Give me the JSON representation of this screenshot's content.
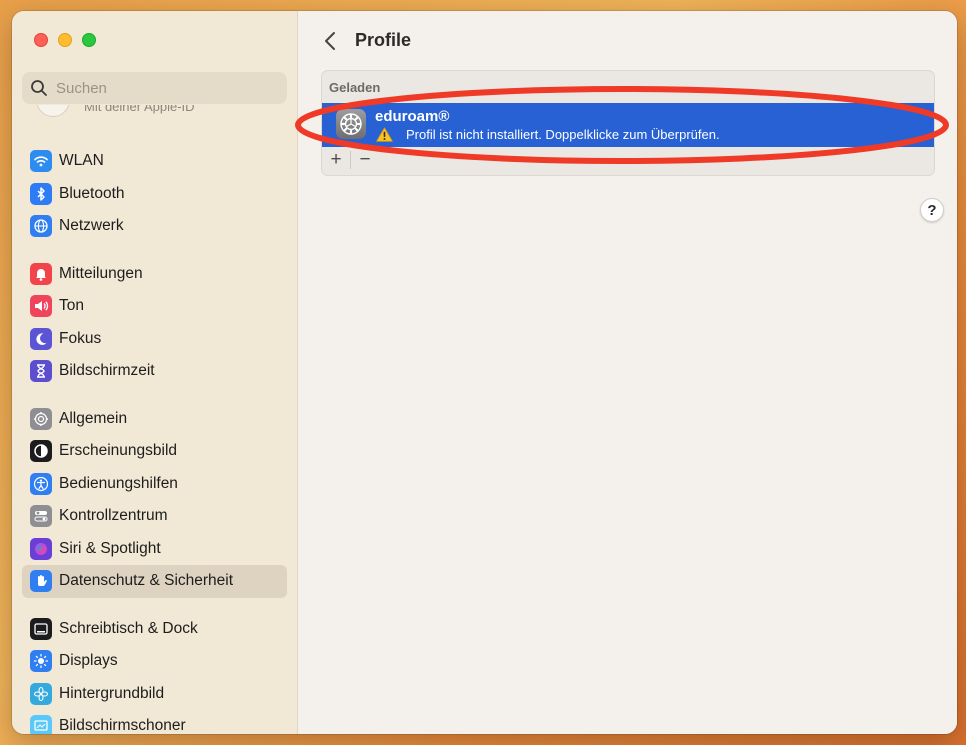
{
  "window": {
    "traffic_lights": [
      "close",
      "minimize",
      "zoom"
    ]
  },
  "sidebar": {
    "search": {
      "placeholder": "Suchen",
      "value": ""
    },
    "apple_id_fragment": "Mit deiner Apple-ID",
    "groups": [
      [
        {
          "label": "WLAN",
          "icon": "wifi-icon",
          "color": "#2d8cf0"
        },
        {
          "label": "Bluetooth",
          "icon": "bluetooth-icon",
          "color": "#2d7cf6"
        },
        {
          "label": "Netzwerk",
          "icon": "globe-icon",
          "color": "#2f7ef2"
        }
      ],
      [
        {
          "label": "Mitteilungen",
          "icon": "bell-icon",
          "color": "#f2454b"
        },
        {
          "label": "Ton",
          "icon": "speaker-icon",
          "color": "#f0445c"
        },
        {
          "label": "Fokus",
          "icon": "moon-icon",
          "color": "#5b55d6"
        },
        {
          "label": "Bildschirmzeit",
          "icon": "hourglass-icon",
          "color": "#5b4fd0"
        }
      ],
      [
        {
          "label": "Allgemein",
          "icon": "gear-icon",
          "color": "#8e8e93"
        },
        {
          "label": "Erscheinungsbild",
          "icon": "appearance-icon",
          "color": "#1c1c1e"
        },
        {
          "label": "Bedienungshilfen",
          "icon": "accessibility-icon",
          "color": "#2f7ef2"
        },
        {
          "label": "Kontrollzentrum",
          "icon": "toggles-icon",
          "color": "#8e8e93"
        },
        {
          "label": "Siri & Spotlight",
          "icon": "siri-icon",
          "color": "#6a3fd6"
        },
        {
          "label": "Datenschutz & Sicherheit",
          "icon": "hand-icon",
          "color": "#2f7ef2",
          "selected": true
        }
      ],
      [
        {
          "label": "Schreibtisch & Dock",
          "icon": "dock-icon",
          "color": "#1c1c1e"
        },
        {
          "label": "Displays",
          "icon": "sun-icon",
          "color": "#2f7ef2"
        },
        {
          "label": "Hintergrundbild",
          "icon": "flower-icon",
          "color": "#34aadc"
        },
        {
          "label": "Bildschirmschoner",
          "icon": "screensaver-icon",
          "color": "#5ac8fa"
        }
      ]
    ]
  },
  "main": {
    "title": "Profile",
    "section_header": "Geladen",
    "profile": {
      "name": "eduroam®",
      "status": "Profil ist nicht installiert. Doppelklicke zum Überprüfen."
    },
    "add_label": "+",
    "remove_label": "−",
    "help_label": "?"
  },
  "colors": {
    "selection_blue": "#2761d4",
    "annotation_red": "#ee3a26"
  }
}
